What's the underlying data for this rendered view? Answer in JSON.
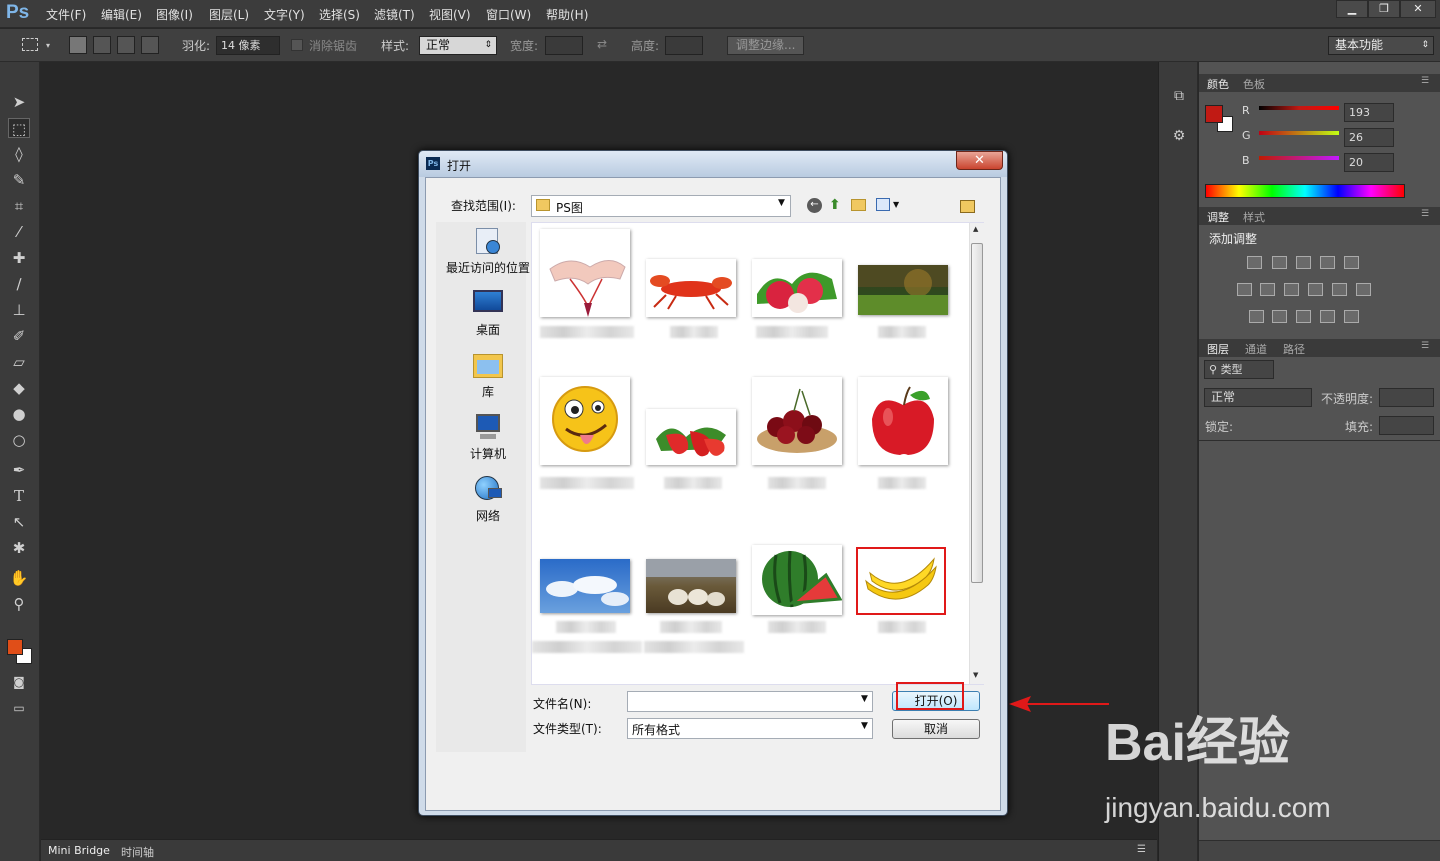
{
  "app": {
    "logo": "Ps"
  },
  "menu": [
    "文件(F)",
    "编辑(E)",
    "图像(I)",
    "图层(L)",
    "文字(Y)",
    "选择(S)",
    "滤镜(T)",
    "视图(V)",
    "窗口(W)",
    "帮助(H)"
  ],
  "window_buttons": [
    "▁",
    "❐",
    "✕"
  ],
  "options": {
    "feather_label": "羽化:",
    "feather_value": "14 像素",
    "antialias_label": "消除锯齿",
    "style_label": "样式:",
    "style_value": "正常",
    "width_label": "宽度:",
    "height_label": "高度:",
    "refine_button": "调整边缘...",
    "workspace": "基本功能"
  },
  "status_tabs": [
    "Mini Bridge",
    "时间轴"
  ],
  "color_panel": {
    "tabs": [
      "颜色",
      "色板"
    ],
    "channels": [
      {
        "label": "R",
        "value": "193"
      },
      {
        "label": "G",
        "value": "26"
      },
      {
        "label": "B",
        "value": "20"
      }
    ],
    "foreground": "#c11a14",
    "background": "#ffffff"
  },
  "adjust_panel": {
    "tabs": [
      "调整",
      "样式"
    ],
    "title": "添加调整"
  },
  "layers_panel": {
    "tabs": [
      "图层",
      "通道",
      "路径"
    ],
    "kind": "类型",
    "blend": "正常",
    "opacity_label": "不透明度:",
    "lock_label": "锁定:",
    "fill_label": "填充:"
  },
  "dialog": {
    "title": "打开",
    "lookin_label": "查找范围(I):",
    "folder": "PS图",
    "places": [
      "最近访问的位置",
      "桌面",
      "库",
      "计算机",
      "网络"
    ],
    "filename_label": "文件名(N):",
    "filename_value": "",
    "filetype_label": "文件类型(T):",
    "filetype_value": "所有格式",
    "open_button": "打开(O)",
    "cancel_button": "取消",
    "files": [
      "hands-necklace",
      "lobster",
      "lychee",
      "forest",
      "emoji-face",
      "strawberry",
      "cherries",
      "apple",
      "sky",
      "sheep",
      "watermelon",
      "banana"
    ],
    "selected_file": "banana"
  },
  "watermark": {
    "brand": "Bai经验",
    "url": "jingyan.baidu.com"
  }
}
